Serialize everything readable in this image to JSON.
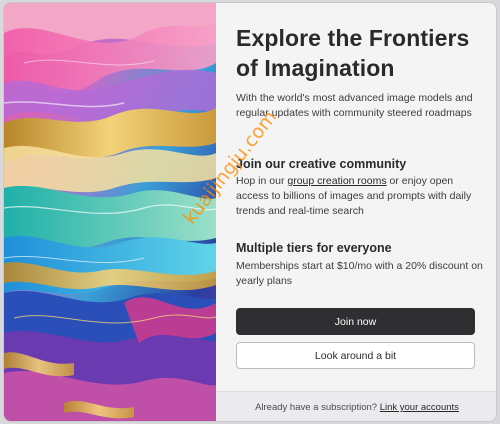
{
  "hero": {
    "title": "Explore the Frontiers of Imagination",
    "intro": "With the world's most advanced image models and regular updates with community steered roadmaps"
  },
  "community": {
    "heading": "Join our creative community",
    "text_before": "Hop in our ",
    "link": "group creation rooms",
    "text_after": " or enjoy open access to billions of images and prompts with daily trends and real-time search"
  },
  "tiers": {
    "heading": "Multiple tiers for everyone",
    "text": "Memberships start at $10/mo with a 20% discount on yearly plans"
  },
  "actions": {
    "join_label": "Join now",
    "look_label": "Look around a bit"
  },
  "footer": {
    "text": "Already have a subscription?",
    "link": "Link your accounts"
  },
  "watermark": {
    "text": "kuaijingju.com",
    "color": "#ff8c00"
  },
  "colors": {
    "primary_button": "#2f2f32",
    "panel_background": "#f4f4f5"
  }
}
